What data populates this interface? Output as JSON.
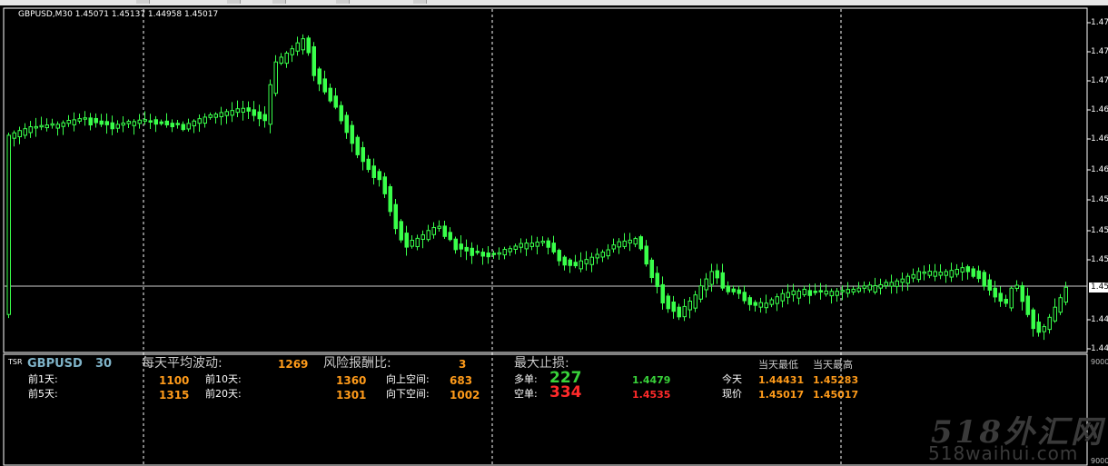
{
  "chart_header": {
    "text": "GBPUSD,M30  1.45071 1.45137 1.44958 1.45017"
  },
  "price_axis": {
    "ticks": [
      "1.47",
      "1.47",
      "1.47",
      "1.46",
      "1.46",
      "1.46",
      "1.45",
      "1.45",
      "1.45",
      "1.44",
      "1.44"
    ],
    "current_price": "1.45"
  },
  "indicator_axis": {
    "ticks": [
      "9000",
      "9000"
    ]
  },
  "tsr_panel": {
    "tag": "TSR",
    "symbol": "GBPUSD",
    "period": "30",
    "avg_label": "每天平均波动:",
    "avg_value": "1269",
    "rr_label": "风险报酬比:",
    "rr_value": "3",
    "maxstop_label": "最大止损:",
    "prev1_label": "前1天:",
    "prev1_value": "1100",
    "prev10_label": "前10天:",
    "prev10_value": "1360",
    "prev5_label": "前5天:",
    "prev5_value": "1315",
    "prev20_label": "前20天:",
    "prev20_value": "1301",
    "up_label": "向上空间:",
    "up_value": "683",
    "down_label": "向下空间:",
    "down_value": "1002",
    "long_label": "多单:",
    "long_value": "227",
    "long_price": "1.4479",
    "short_label": "空单:",
    "short_value": "334",
    "short_price": "1.4535",
    "today_low_label": "当天最低",
    "today_high_label": "当天最高",
    "today_label": "今天",
    "today_low": "1.44431",
    "today_high": "1.45283",
    "now_label": "现价",
    "now_low": "1.45017",
    "now_high": "1.45017"
  },
  "watermark": {
    "line1": "518外汇网",
    "line2": "518waihui.com"
  },
  "colors": {
    "background": "#000000",
    "candle": "#39ff4a",
    "grid": "#ffffff",
    "orange": "#ff9b1a",
    "green": "#39d23a",
    "red": "#ff2a2a"
  }
}
